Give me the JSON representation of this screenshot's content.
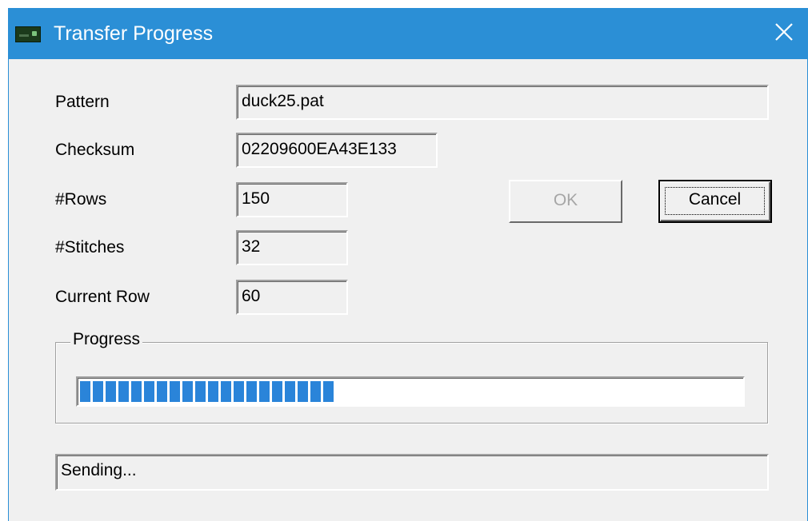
{
  "window": {
    "title": "Transfer Progress",
    "titlebar_color": "#2b8fd6",
    "icon": "app-device-icon",
    "close_icon": "close-icon"
  },
  "form": {
    "pattern_label": "Pattern",
    "pattern_value": "duck25.pat",
    "checksum_label": "Checksum",
    "checksum_value": "02209600EA43E133",
    "rows_label": "#Rows",
    "rows_value": "150",
    "stitches_label": "#Stitches",
    "stitches_value": "32",
    "current_row_label": "Current Row",
    "current_row_value": "60"
  },
  "buttons": {
    "ok_label": "OK",
    "ok_enabled": false,
    "cancel_label": "Cancel"
  },
  "progress": {
    "group_label": "Progress",
    "fraction": 0.4,
    "fill_color": "#2a84d9"
  },
  "status": {
    "text": "Sending..."
  }
}
